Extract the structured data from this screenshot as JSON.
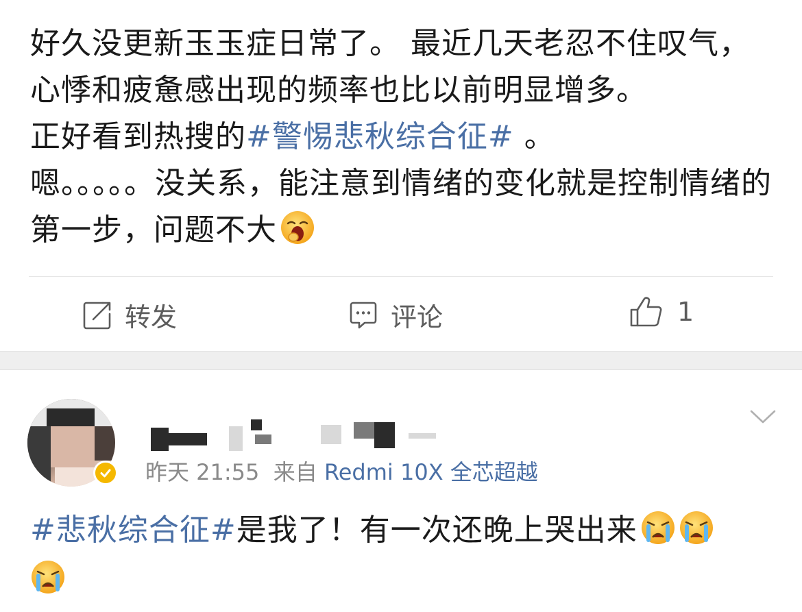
{
  "post": {
    "text_1": "好久没更新玉玉症日常了。 最近几天老忍不住叹气，心悸和疲惫感出现的频率也比以前明显增多。",
    "text_2_prefix": "正好看到热搜的",
    "hashtag": "#警惕悲秋综合征#",
    "text_2_suffix": " 。",
    "text_3": "嗯。。。。。没关系，能注意到情绪的变化就是控制情绪的第一步，问题不大",
    "emoji_icon": "yawn-emoji-icon"
  },
  "actions": {
    "repost_label": "转发",
    "comment_label": "评论",
    "like_count": "1"
  },
  "comment": {
    "time": "昨天 21:55",
    "from_label": "来自",
    "source": "Redmi 10X 全芯超越",
    "hashtag": "#悲秋综合征#",
    "text": "是我了！有一次还晚上哭出来",
    "crying_emoji_icon": "crying-emoji-icon"
  },
  "colors": {
    "link": "#4a6fa5",
    "meta": "#8a8a8a",
    "action": "#5c5c5c",
    "band": "#efefef",
    "verified": "#f5b800"
  }
}
